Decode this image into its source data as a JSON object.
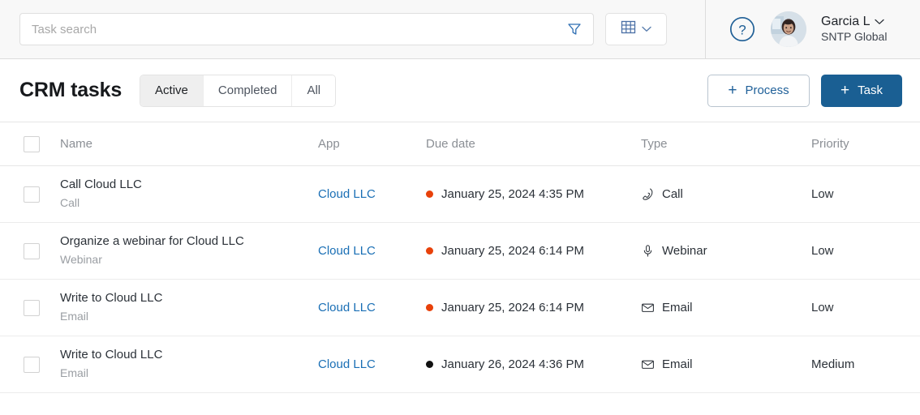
{
  "toolbar": {
    "search_placeholder": "Task search",
    "search_value": "",
    "filter_icon": "funnel-icon",
    "view_icon": "table-grid-icon",
    "view_chevron_icon": "chevron-down-icon"
  },
  "account": {
    "help_icon": "question-circle-icon",
    "avatar_icon": "user-avatar",
    "user_name": "Garcia L",
    "user_chevron_icon": "chevron-down-icon",
    "organization": "SNTP Global"
  },
  "header": {
    "title": "CRM tasks",
    "tabs": [
      {
        "label": "Active",
        "active": true
      },
      {
        "label": "Completed",
        "active": false
      },
      {
        "label": "All",
        "active": false
      }
    ],
    "process_button": "Process",
    "task_button": "Task",
    "plus_glyph": "+"
  },
  "table": {
    "columns": [
      "Name",
      "App",
      "Due date",
      "Type",
      "Priority"
    ],
    "select_all_checkbox": "unchecked",
    "rows": [
      {
        "title": "Call Cloud LLC",
        "subtitle": "Call",
        "app": "Cloud LLC",
        "due_date": "January 25, 2024 4:35 PM",
        "due_dot_color": "#e8410a",
        "type": "Call",
        "type_icon": "phone-icon",
        "priority": "Low"
      },
      {
        "title": "Organize a webinar for Cloud LLC",
        "subtitle": "Webinar",
        "app": "Cloud LLC",
        "due_date": "January 25, 2024 6:14 PM",
        "due_dot_color": "#e8410a",
        "type": "Webinar",
        "type_icon": "microphone-icon",
        "priority": "Low"
      },
      {
        "title": "Write to Cloud LLC",
        "subtitle": "Email",
        "app": "Cloud LLC",
        "due_date": "January 25, 2024 6:14 PM",
        "due_dot_color": "#e8410a",
        "type": "Email",
        "type_icon": "envelope-icon",
        "priority": "Low"
      },
      {
        "title": "Write to Cloud LLC",
        "subtitle": "Email",
        "app": "Cloud LLC",
        "due_date": "January 26, 2024 4:36 PM",
        "due_dot_color": "#111111",
        "type": "Email",
        "type_icon": "envelope-icon",
        "priority": "Medium"
      }
    ]
  },
  "colors": {
    "accent_blue": "#1a5f93",
    "link_blue": "#1a6fb5",
    "overdue_red": "#e8410a",
    "neutral_dot": "#111111"
  }
}
